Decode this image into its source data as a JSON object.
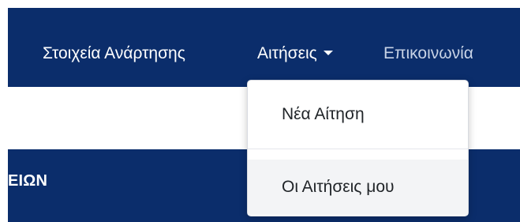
{
  "navbar": {
    "links": [
      {
        "label": "Στοιχεία Ανάρτησης"
      },
      {
        "label": "Αιτήσεις"
      },
      {
        "label": "Επικοινωνία"
      }
    ]
  },
  "dropdown": {
    "items": [
      {
        "label": "Νέα Αίτηση"
      },
      {
        "label": "Οι Αιτήσεις μου"
      }
    ]
  },
  "band": {
    "title": "ΕΙΩΝ"
  },
  "colors": {
    "navbar_bg": "#0b2d6b",
    "nav_text": "#ffffff",
    "nav_text_muted": "#c8d3e6",
    "dropdown_hover_bg": "#f3f4f6"
  }
}
